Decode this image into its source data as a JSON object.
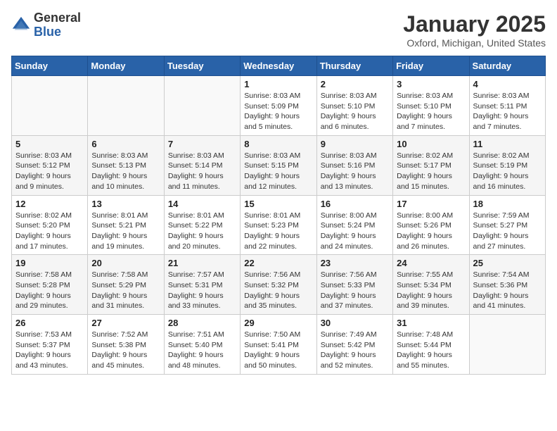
{
  "header": {
    "logo_general": "General",
    "logo_blue": "Blue",
    "month_title": "January 2025",
    "location": "Oxford, Michigan, United States"
  },
  "weekdays": [
    "Sunday",
    "Monday",
    "Tuesday",
    "Wednesday",
    "Thursday",
    "Friday",
    "Saturday"
  ],
  "weeks": [
    [
      {
        "day": "",
        "info": ""
      },
      {
        "day": "",
        "info": ""
      },
      {
        "day": "",
        "info": ""
      },
      {
        "day": "1",
        "info": "Sunrise: 8:03 AM\nSunset: 5:09 PM\nDaylight: 9 hours\nand 5 minutes."
      },
      {
        "day": "2",
        "info": "Sunrise: 8:03 AM\nSunset: 5:10 PM\nDaylight: 9 hours\nand 6 minutes."
      },
      {
        "day": "3",
        "info": "Sunrise: 8:03 AM\nSunset: 5:10 PM\nDaylight: 9 hours\nand 7 minutes."
      },
      {
        "day": "4",
        "info": "Sunrise: 8:03 AM\nSunset: 5:11 PM\nDaylight: 9 hours\nand 7 minutes."
      }
    ],
    [
      {
        "day": "5",
        "info": "Sunrise: 8:03 AM\nSunset: 5:12 PM\nDaylight: 9 hours\nand 9 minutes."
      },
      {
        "day": "6",
        "info": "Sunrise: 8:03 AM\nSunset: 5:13 PM\nDaylight: 9 hours\nand 10 minutes."
      },
      {
        "day": "7",
        "info": "Sunrise: 8:03 AM\nSunset: 5:14 PM\nDaylight: 9 hours\nand 11 minutes."
      },
      {
        "day": "8",
        "info": "Sunrise: 8:03 AM\nSunset: 5:15 PM\nDaylight: 9 hours\nand 12 minutes."
      },
      {
        "day": "9",
        "info": "Sunrise: 8:03 AM\nSunset: 5:16 PM\nDaylight: 9 hours\nand 13 minutes."
      },
      {
        "day": "10",
        "info": "Sunrise: 8:02 AM\nSunset: 5:17 PM\nDaylight: 9 hours\nand 15 minutes."
      },
      {
        "day": "11",
        "info": "Sunrise: 8:02 AM\nSunset: 5:19 PM\nDaylight: 9 hours\nand 16 minutes."
      }
    ],
    [
      {
        "day": "12",
        "info": "Sunrise: 8:02 AM\nSunset: 5:20 PM\nDaylight: 9 hours\nand 17 minutes."
      },
      {
        "day": "13",
        "info": "Sunrise: 8:01 AM\nSunset: 5:21 PM\nDaylight: 9 hours\nand 19 minutes."
      },
      {
        "day": "14",
        "info": "Sunrise: 8:01 AM\nSunset: 5:22 PM\nDaylight: 9 hours\nand 20 minutes."
      },
      {
        "day": "15",
        "info": "Sunrise: 8:01 AM\nSunset: 5:23 PM\nDaylight: 9 hours\nand 22 minutes."
      },
      {
        "day": "16",
        "info": "Sunrise: 8:00 AM\nSunset: 5:24 PM\nDaylight: 9 hours\nand 24 minutes."
      },
      {
        "day": "17",
        "info": "Sunrise: 8:00 AM\nSunset: 5:26 PM\nDaylight: 9 hours\nand 26 minutes."
      },
      {
        "day": "18",
        "info": "Sunrise: 7:59 AM\nSunset: 5:27 PM\nDaylight: 9 hours\nand 27 minutes."
      }
    ],
    [
      {
        "day": "19",
        "info": "Sunrise: 7:58 AM\nSunset: 5:28 PM\nDaylight: 9 hours\nand 29 minutes."
      },
      {
        "day": "20",
        "info": "Sunrise: 7:58 AM\nSunset: 5:29 PM\nDaylight: 9 hours\nand 31 minutes."
      },
      {
        "day": "21",
        "info": "Sunrise: 7:57 AM\nSunset: 5:31 PM\nDaylight: 9 hours\nand 33 minutes."
      },
      {
        "day": "22",
        "info": "Sunrise: 7:56 AM\nSunset: 5:32 PM\nDaylight: 9 hours\nand 35 minutes."
      },
      {
        "day": "23",
        "info": "Sunrise: 7:56 AM\nSunset: 5:33 PM\nDaylight: 9 hours\nand 37 minutes."
      },
      {
        "day": "24",
        "info": "Sunrise: 7:55 AM\nSunset: 5:34 PM\nDaylight: 9 hours\nand 39 minutes."
      },
      {
        "day": "25",
        "info": "Sunrise: 7:54 AM\nSunset: 5:36 PM\nDaylight: 9 hours\nand 41 minutes."
      }
    ],
    [
      {
        "day": "26",
        "info": "Sunrise: 7:53 AM\nSunset: 5:37 PM\nDaylight: 9 hours\nand 43 minutes."
      },
      {
        "day": "27",
        "info": "Sunrise: 7:52 AM\nSunset: 5:38 PM\nDaylight: 9 hours\nand 45 minutes."
      },
      {
        "day": "28",
        "info": "Sunrise: 7:51 AM\nSunset: 5:40 PM\nDaylight: 9 hours\nand 48 minutes."
      },
      {
        "day": "29",
        "info": "Sunrise: 7:50 AM\nSunset: 5:41 PM\nDaylight: 9 hours\nand 50 minutes."
      },
      {
        "day": "30",
        "info": "Sunrise: 7:49 AM\nSunset: 5:42 PM\nDaylight: 9 hours\nand 52 minutes."
      },
      {
        "day": "31",
        "info": "Sunrise: 7:48 AM\nSunset: 5:44 PM\nDaylight: 9 hours\nand 55 minutes."
      },
      {
        "day": "",
        "info": ""
      }
    ]
  ]
}
